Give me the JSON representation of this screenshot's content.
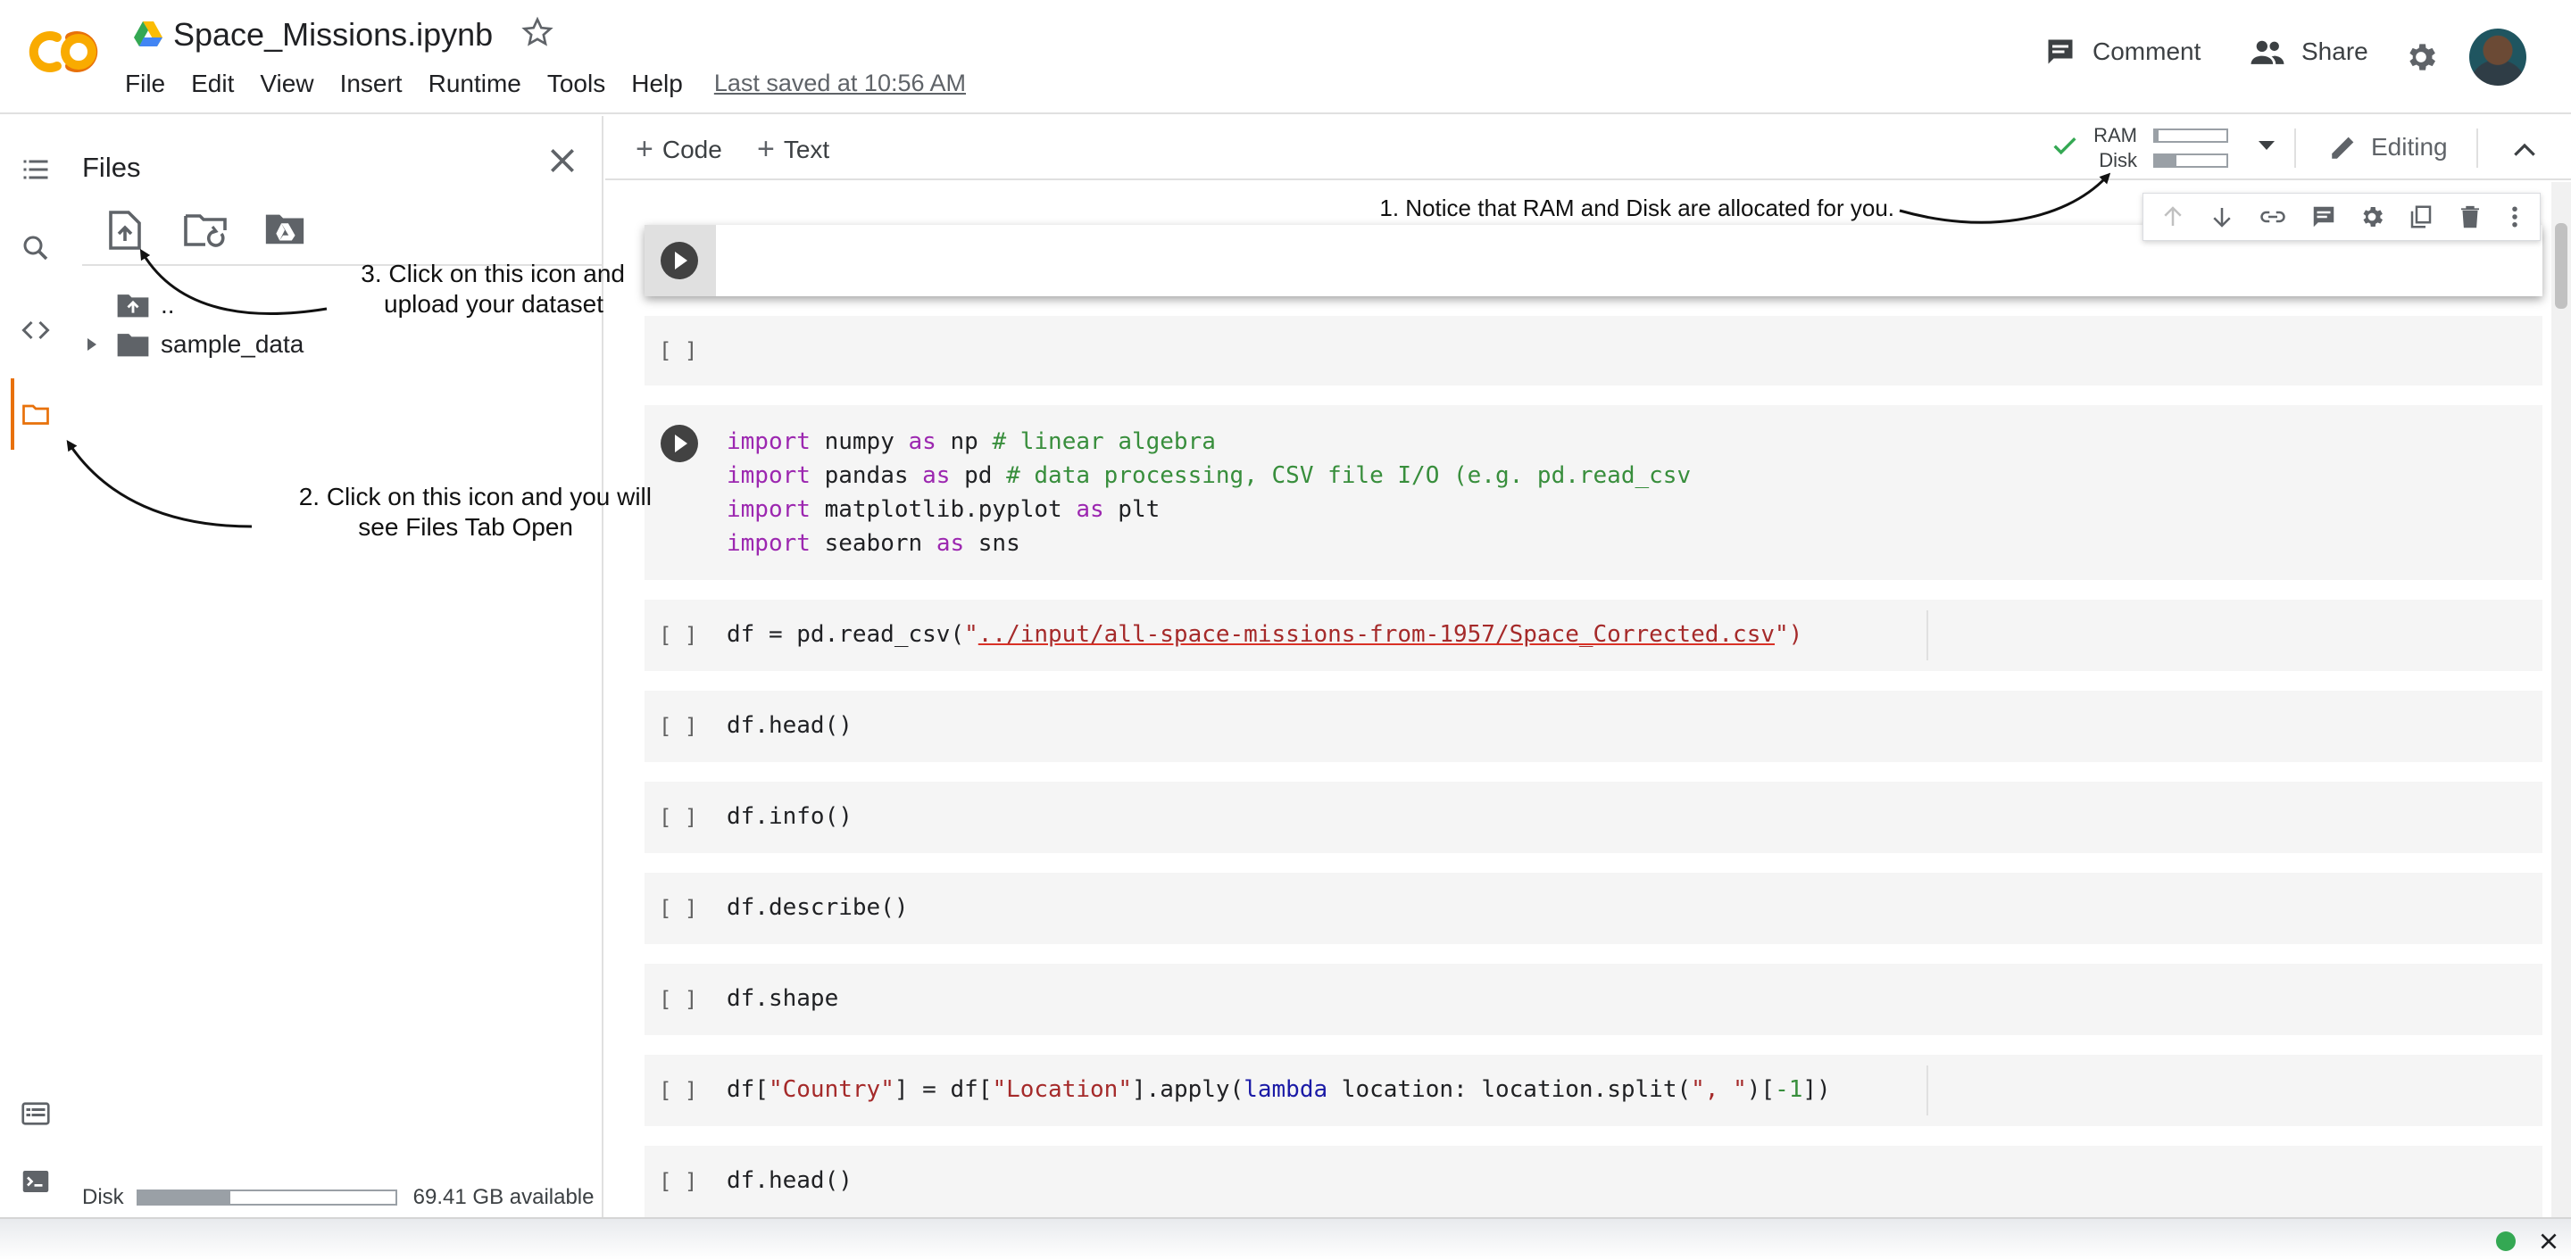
{
  "header": {
    "doc_title": "Space_Missions.ipynb",
    "menu": [
      "File",
      "Edit",
      "View",
      "Insert",
      "Runtime",
      "Tools",
      "Help"
    ],
    "last_saved": "Last saved at 10:56 AM",
    "comment_label": "Comment",
    "share_label": "Share"
  },
  "files_panel": {
    "title": "Files",
    "tree": [
      {
        "label": ".."
      },
      {
        "label": "sample_data"
      }
    ],
    "disk_label": "Disk",
    "disk_available": "69.41 GB available",
    "disk_used_fraction": 0.36
  },
  "toolbar": {
    "add_code": "Code",
    "add_text": "Text",
    "ram_label": "RAM",
    "disk_label": "Disk",
    "ram_used_fraction": 0.05,
    "disk_used_fraction": 0.3,
    "editing_label": "Editing"
  },
  "cells": {
    "empty_bracket": "[ ]",
    "c2_l1": [
      "import",
      " numpy ",
      "as",
      " np ",
      "# linear algebra"
    ],
    "c2_l2": [
      "import",
      " pandas ",
      "as",
      " pd ",
      "# data processing, CSV file I/O (e.g. pd.read_csv"
    ],
    "c2_l3": [
      "import",
      " matplotlib.pyplot ",
      "as",
      " plt"
    ],
    "c2_l4": [
      "import",
      " seaborn ",
      "as",
      " sns"
    ],
    "c3": [
      "df = pd.read_csv(",
      "\"",
      "../input/all-space-missions-from-1957/Space_Corrected.csv",
      "\")"
    ],
    "c4": "df.head()",
    "c5": "df.info()",
    "c6": "df.describe()",
    "c7": "df.shape",
    "c8": [
      "df[",
      "\"Country\"",
      "] = df[",
      "\"Location\"",
      "].apply(",
      "lambda",
      " location: location.split(",
      "\", \"",
      ")[",
      "-1",
      "])"
    ],
    "c9": "df.head()"
  },
  "annotations": {
    "a1": "1. Notice that RAM and Disk are allocated for you.",
    "a2_l1": "2. Click on this icon and you will",
    "a2_l2": "see Files Tab Open",
    "a3_l1": "3. Click on this icon and",
    "a3_l2": "upload your dataset"
  },
  "colors": {
    "accent": "#e8710a",
    "keyword": "#9c27b0",
    "comment": "#388e3c",
    "string": "#a52a2a",
    "status_ok": "#34a853"
  }
}
